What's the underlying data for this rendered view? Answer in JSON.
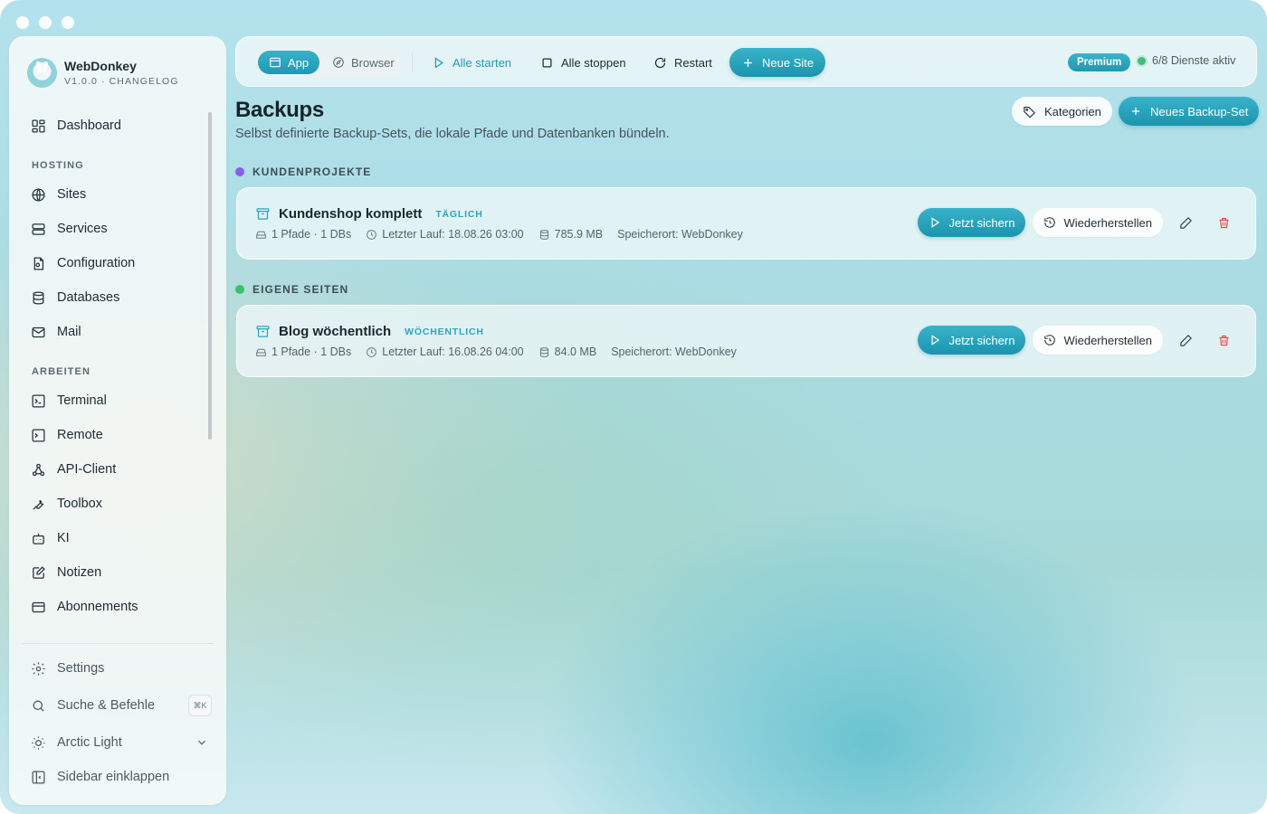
{
  "app": {
    "name": "WebDonkey",
    "version_line": "V1.0.0 · CHANGELOG"
  },
  "sidebar": {
    "dashboard": "Dashboard",
    "sections": {
      "hosting": "HOSTING",
      "arbeiten": "ARBEITEN"
    },
    "hosting_items": [
      {
        "label": "Sites",
        "icon": "globe-icon"
      },
      {
        "label": "Services",
        "icon": "server-icon"
      },
      {
        "label": "Configuration",
        "icon": "config-file-icon"
      },
      {
        "label": "Databases",
        "icon": "database-icon"
      },
      {
        "label": "Mail",
        "icon": "mail-icon"
      }
    ],
    "arbeiten_items": [
      {
        "label": "Terminal",
        "icon": "terminal-icon"
      },
      {
        "label": "Remote",
        "icon": "remote-icon"
      },
      {
        "label": "API-Client",
        "icon": "api-icon"
      },
      {
        "label": "Toolbox",
        "icon": "wrench-icon"
      },
      {
        "label": "KI",
        "icon": "bot-icon"
      },
      {
        "label": "Notizen",
        "icon": "notes-icon"
      },
      {
        "label": "Abonnements",
        "icon": "card-icon"
      }
    ],
    "footer": {
      "settings": "Settings",
      "search": "Suche & Befehle",
      "search_shortcut": "⌘K",
      "theme": "Arctic Light",
      "collapse": "Sidebar einklappen"
    }
  },
  "topbar": {
    "mode_app": "App",
    "mode_browser": "Browser",
    "start_all": "Alle starten",
    "stop_all": "Alle stoppen",
    "restart": "Restart",
    "new_site": "Neue Site",
    "premium": "Premium",
    "services_status": "6/8 Dienste aktiv"
  },
  "page": {
    "title": "Backups",
    "subtitle": "Selbst definierte Backup-Sets, die lokale Pfade und Datenbanken bündeln.",
    "categories_button": "Kategorien",
    "new_backup_button": "Neues Backup-Set"
  },
  "groups": [
    {
      "label": "KUNDENPROJEKTE",
      "color": "#8a5cf0",
      "backups": [
        {
          "name": "Kundenshop komplett",
          "frequency": "TÄGLICH",
          "paths": "1 Pfade · 1 DBs",
          "last_run": "Letzter Lauf: 18.08.26 03:00",
          "size": "785.9 MB",
          "location": "Speicherort: WebDonkey"
        }
      ]
    },
    {
      "label": "EIGENE SEITEN",
      "color": "#3cbf6a",
      "backups": [
        {
          "name": "Blog wöchentlich",
          "frequency": "WÖCHENTLICH",
          "paths": "1 Pfade · 1 DBs",
          "last_run": "Letzter Lauf: 16.08.26 04:00",
          "size": "84.0 MB",
          "location": "Speicherort: WebDonkey"
        }
      ]
    }
  ],
  "actions": {
    "backup_now": "Jetzt sichern",
    "restore": "Wiederherstellen"
  },
  "colors": {
    "accent": "#2aa6c0",
    "danger": "#e04848",
    "status_green": "#3cbf7a"
  }
}
